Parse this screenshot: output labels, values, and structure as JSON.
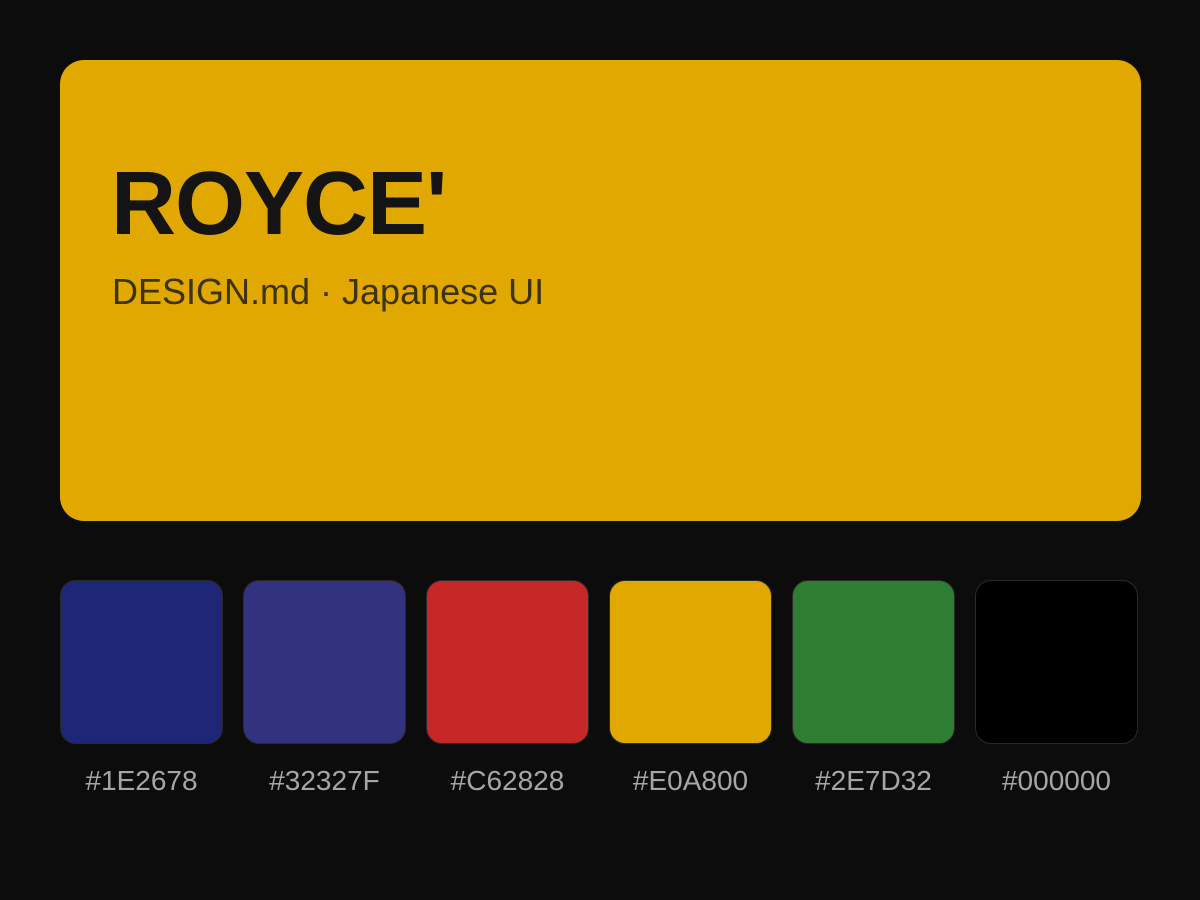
{
  "hero": {
    "title": "ROYCE'",
    "subtitle": "DESIGN.md · Japanese UI",
    "background_color": "#E0A800"
  },
  "palette": [
    {
      "label": "#1E2678",
      "color": "#1E2678"
    },
    {
      "label": "#32327F",
      "color": "#32327F"
    },
    {
      "label": "#C62828",
      "color": "#C62828"
    },
    {
      "label": "#E0A800",
      "color": "#E0A800"
    },
    {
      "label": "#2E7D32",
      "color": "#2E7D32"
    },
    {
      "label": "#000000",
      "color": "#000000"
    }
  ]
}
